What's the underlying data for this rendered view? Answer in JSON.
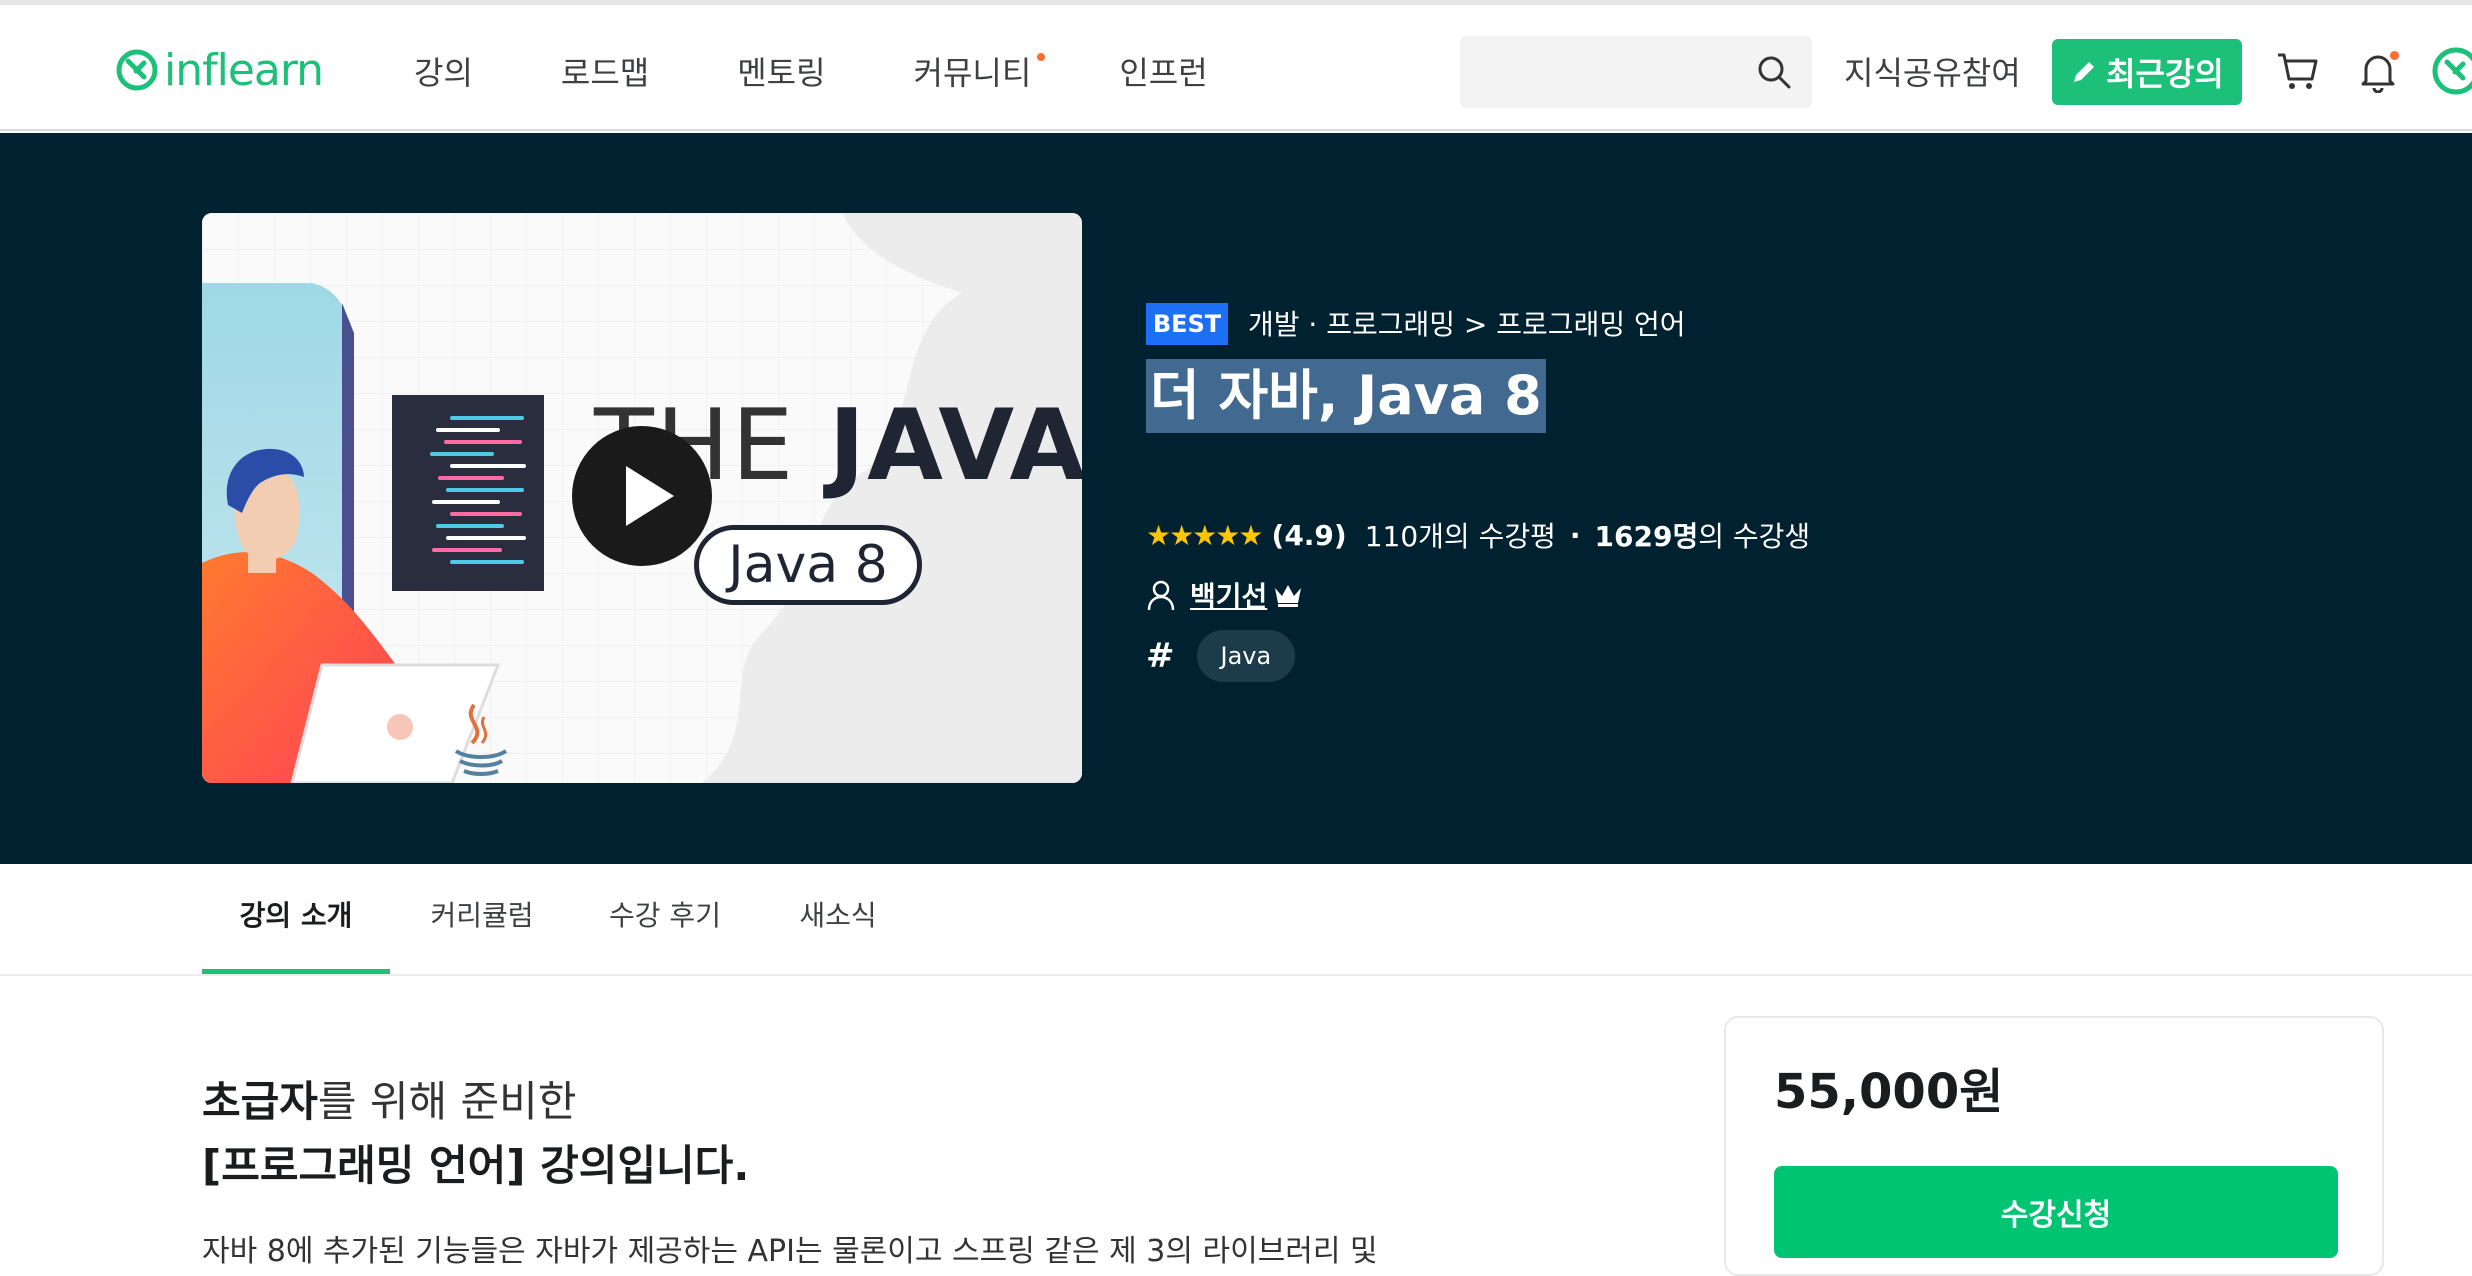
{
  "header": {
    "logo_text": "inflearn",
    "nav": [
      "강의",
      "로드맵",
      "멘토링",
      "커뮤니티",
      "인프런"
    ],
    "search_placeholder": "",
    "share_label": "지식공유참여",
    "recent_label": "최근강의",
    "brand_color": "#1dc078",
    "notification_dot_color": "#ff6d2e"
  },
  "hero": {
    "background": "#00212f",
    "thumbnail": {
      "title_light": "THE",
      "title_bold": "JAVA",
      "pill": "Java 8"
    },
    "badge": "BEST",
    "category": "개발 · 프로그래밍 > 프로그래밍 언어",
    "title": "더 자바, Java 8",
    "stars": "★★★★★",
    "rating": "(4.9)",
    "reviews": "110개의 수강평",
    "separator": "·",
    "students_bold": "1629명",
    "students_suffix": "의 수강생",
    "instructor": "백기선",
    "tag": "Java"
  },
  "tabs": [
    "강의 소개",
    "커리큘럼",
    "수강 후기",
    "새소식"
  ],
  "intro": {
    "line1_bold": "초급자",
    "line1_rest": "를 위해 준비한",
    "line2": "[프로그래밍 언어] 강의입니다.",
    "desc": "자바 8에 추가된 기능들은 자바가 제공하는 API는 물론이고 스프링 같은 제 3의 라이브러리 및"
  },
  "price_card": {
    "price": "55,000원",
    "enroll_label": "수강신청"
  }
}
